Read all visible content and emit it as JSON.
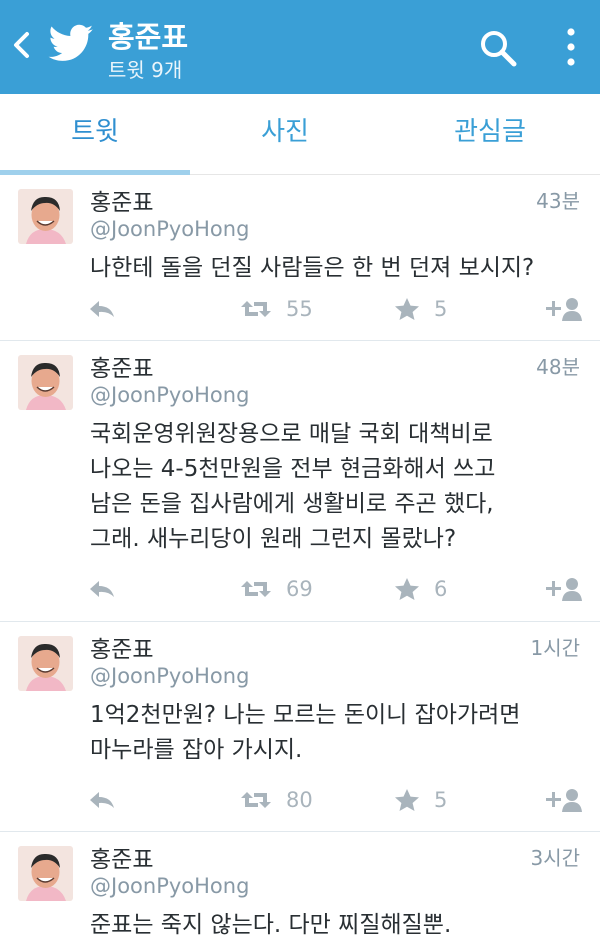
{
  "header": {
    "title": "홍준표",
    "subtitle": "트윗 9개",
    "color": "#3a9fd6"
  },
  "tabs": [
    {
      "label": "트윗",
      "selected": true
    },
    {
      "label": "사진",
      "selected": false
    },
    {
      "label": "관심글",
      "selected": false
    }
  ],
  "tweets": [
    {
      "name": "홍준표",
      "handle": "@JoonPyoHong",
      "time": "43분",
      "text": "나한테 돌을 던질 사람들은 한 번 던져 보시지?",
      "retweets": "55",
      "favorites": "5"
    },
    {
      "name": "홍준표",
      "handle": "@JoonPyoHong",
      "time": "48분",
      "text": "국회운영위원장용으로 매달 국회 대책비로\n나오는 4-5천만원을 전부 현금화해서 쓰고\n남은 돈을 집사람에게 생활비로 주곤 했다,\n그래. 새누리당이 원래 그런지 몰랐나?",
      "retweets": "69",
      "favorites": "6"
    },
    {
      "name": "홍준표",
      "handle": "@JoonPyoHong",
      "time": "1시간",
      "text": "1억2천만원? 나는 모르는 돈이니 잡아가려면\n마누라를 잡아 가시지.",
      "retweets": "80",
      "favorites": "5"
    },
    {
      "name": "홍준표",
      "handle": "@JoonPyoHong",
      "time": "3시간",
      "text": "준표는 죽지 않는다. 다만 찌질해질뿐.",
      "retweets": "",
      "favorites": ""
    }
  ]
}
